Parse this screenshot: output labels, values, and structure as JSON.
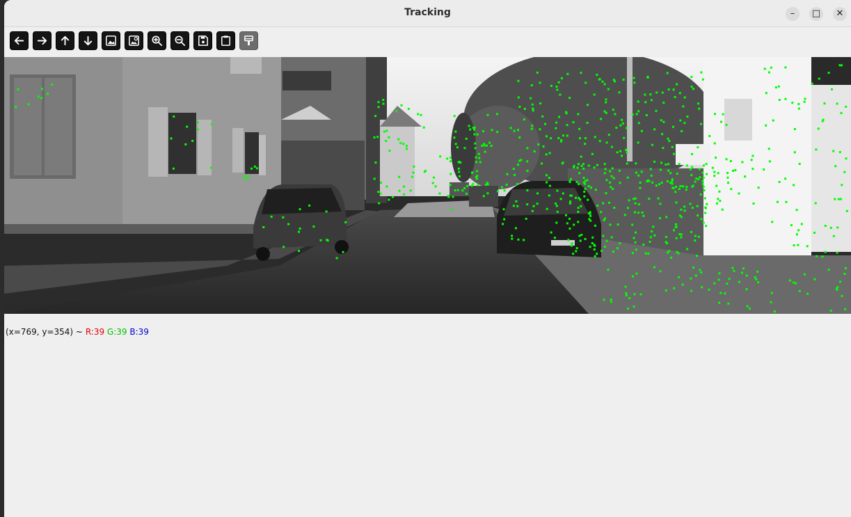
{
  "window": {
    "title": "Tracking"
  },
  "toolbar": {
    "buttons": [
      {
        "name": "pan-left-button",
        "icon": "arrow-left-icon",
        "enabled": true
      },
      {
        "name": "pan-right-button",
        "icon": "arrow-right-icon",
        "enabled": true
      },
      {
        "name": "pan-up-button",
        "icon": "arrow-up-icon",
        "enabled": true
      },
      {
        "name": "pan-down-button",
        "icon": "arrow-down-icon",
        "enabled": true
      },
      {
        "name": "zoom-fit-button",
        "icon": "image-icon",
        "enabled": true
      },
      {
        "name": "zoom-original-button",
        "icon": "image-zoom-icon",
        "enabled": true
      },
      {
        "name": "zoom-in-button",
        "icon": "zoom-in-icon",
        "enabled": true
      },
      {
        "name": "zoom-out-button",
        "icon": "zoom-out-icon",
        "enabled": true
      },
      {
        "name": "save-image-button",
        "icon": "save-icon",
        "enabled": true
      },
      {
        "name": "copy-clipboard-button",
        "icon": "clipboard-icon",
        "enabled": true
      },
      {
        "name": "properties-button",
        "icon": "paint-brush-icon",
        "enabled": false
      }
    ]
  },
  "image": {
    "description_icon": "grayscale-street-frame-with-green-feature-points",
    "keypoint_color": "#00ff00"
  },
  "status": {
    "coords": "(x=769, y=354) ~",
    "r": "R:39",
    "g": "G:39",
    "b": "B:39"
  },
  "colors": {
    "r": "#e00000",
    "g": "#00c000",
    "b": "#0000d0"
  }
}
